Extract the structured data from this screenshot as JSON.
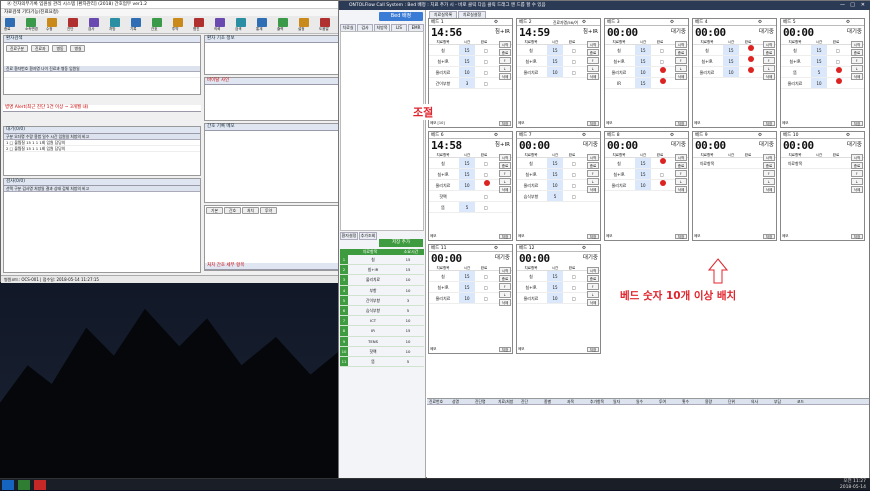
{
  "left_window": {
    "title": "Ⓐ 전자의무기록 입원실 관리 시스템 [환자관리] (2018) 간호업무 ver1.2",
    "menu": "자료검색   기타기능(진료요청)",
    "toolbar": [
      "종료",
      "소속변경",
      "수정",
      "진단",
      "검사",
      "처방",
      "기록",
      "간호",
      "투약",
      "협진",
      "의뢰",
      "검색",
      "통계",
      "출력",
      "설정",
      "도움말"
    ],
    "patient_panel_title": "환자검색",
    "patient_panel_fields": [
      "진료구분",
      "진료과",
      "병동",
      "병실"
    ],
    "patient_list_header": [
      "진료",
      "환자번호",
      "환자명",
      "나이",
      "진료과",
      "병동",
      "입원일"
    ],
    "alert_text": "병명 Alert(최근 진단 1건 이상 ~ 3개월 내)",
    "order_title": "대기(0/0)",
    "order_header": [
      "구분",
      "오더명",
      "수량",
      "용법",
      "일수",
      "시간",
      "입원일",
      "처방의",
      "비고"
    ],
    "order_rows": [
      [
        "1",
        "□",
        "물찜질",
        "15",
        "1",
        "1",
        "1회",
        "입원",
        "담당의"
      ],
      [
        "2",
        "□",
        "물찜질",
        "15",
        "1",
        "1",
        "1회",
        "입원",
        "담당의"
      ]
    ],
    "exam_title": "검사(0/0)",
    "exam_header": [
      "선택",
      "구분",
      "검사명",
      "처방일",
      "결과",
      "상태",
      "검체",
      "처방의",
      "비고"
    ],
    "status": "병원코드: OCS-001 | 접수일: 2018-05-14 11:27:15",
    "right_panel_title": "환자 기초 정보",
    "vitals_title": "바이탈 사인",
    "memo_title": "간호 기록 메모",
    "care_tabs": [
      "기본",
      "간호",
      "처치",
      "투약"
    ],
    "care_title": "처치 간호 세부 항목"
  },
  "annotation": {
    "label1": "조절",
    "label2": "베드 숫자 10개 이상 배치"
  },
  "right_window": {
    "title": "ONTOLFlow Call System : Bed 배정 : 치료 추가 시 - 바로 클릭 다음 클릭 드래그 앤 드롭 할 수 있음",
    "sidebar_tabs": [
      "치료실",
      "검사",
      "처방목록",
      "LIS",
      "EMR"
    ],
    "bed_button": "Bed 배정",
    "top_tabs": [
      "치료실목록",
      "치료실설정"
    ],
    "list_button": "저장 추가",
    "sidebar_header": [
      "치료항목",
      "소요시간"
    ],
    "sidebar_rows": [
      {
        "n": "1",
        "name": "침",
        "v": "15"
      },
      {
        "n": "2",
        "name": "침+IR",
        "v": "15"
      },
      {
        "n": "3",
        "name": "물리치료",
        "v": "10"
      },
      {
        "n": "4",
        "name": "부항",
        "v": "10"
      },
      {
        "n": "5",
        "name": "간이부항",
        "v": "3"
      },
      {
        "n": "6",
        "name": "습식부항",
        "v": "5"
      },
      {
        "n": "7",
        "name": "ICT",
        "v": "10"
      },
      {
        "n": "8",
        "name": "IR",
        "v": "15"
      },
      {
        "n": "9",
        "name": "TENS",
        "v": "10"
      },
      {
        "n": "10",
        "name": "핫팩",
        "v": "10"
      },
      {
        "n": "11",
        "name": "뜸",
        "v": "5"
      }
    ],
    "beds": [
      {
        "name": "베드 1",
        "time": "14:56",
        "status": "침+IR",
        "extra": "",
        "rows": [
          [
            "침",
            "15",
            "r"
          ],
          [
            "침+IR",
            "15",
            "r"
          ],
          [
            "물리치료",
            "10",
            "r"
          ],
          [
            "간이부항",
            "3",
            "r"
          ]
        ],
        "memo": "메모 [10]"
      },
      {
        "name": "베드 2",
        "time": "14:59",
        "status": "침+IR",
        "extra": "진료자명/56/여",
        "rows": [
          [
            "침",
            "15",
            "r"
          ],
          [
            "침+IR",
            "15",
            "r"
          ],
          [
            "물리치료",
            "10",
            "r"
          ]
        ],
        "memo": "메모"
      },
      {
        "name": "베드 3",
        "time": "00:00",
        "status": "대기중",
        "extra": "",
        "rows": [
          [
            "침",
            "15",
            "r"
          ],
          [
            "침+IR",
            "15",
            "r"
          ],
          [
            "물리치료",
            "10",
            "b"
          ],
          [
            "IR",
            "15",
            "b"
          ]
        ],
        "memo": "메모"
      },
      {
        "name": "베드 4",
        "time": "00:00",
        "status": "대기중",
        "extra": "",
        "rows": [
          [
            "침",
            "15",
            "b"
          ],
          [
            "침+IR",
            "15",
            "b"
          ],
          [
            "물리치료",
            "10",
            "b"
          ]
        ],
        "memo": "메모"
      },
      {
        "name": "베드 5",
        "time": "00:00",
        "status": "대기중",
        "extra": "",
        "rows": [
          [
            "침",
            "15",
            "r"
          ],
          [
            "침+IR",
            "15",
            "r"
          ],
          [
            "뜸",
            "5",
            "b"
          ],
          [
            "물리치료",
            "10",
            "b"
          ]
        ],
        "memo": "메모"
      },
      {
        "name": "베드 6",
        "time": "14:58",
        "status": "침+IR",
        "extra": "",
        "rows": [
          [
            "침",
            "15",
            "r"
          ],
          [
            "침+IR",
            "15",
            "r"
          ],
          [
            "물리치료",
            "10",
            "b"
          ],
          [
            "핫팩",
            "",
            "r"
          ],
          [
            "뜸",
            "5",
            "r"
          ]
        ],
        "memo": "메모"
      },
      {
        "name": "베드 7",
        "time": "00:00",
        "status": "대기중",
        "extra": "",
        "rows": [
          [
            "침",
            "15",
            "r"
          ],
          [
            "침+IR",
            "15",
            "r"
          ],
          [
            "물리치료",
            "10",
            "r"
          ],
          [
            "습식부항",
            "5",
            "r"
          ]
        ],
        "memo": "메모"
      },
      {
        "name": "베드 8",
        "time": "00:00",
        "status": "대기중",
        "extra": "",
        "rows": [
          [
            "침",
            "15",
            "b"
          ],
          [
            "침+IR",
            "15",
            "r"
          ],
          [
            "물리치료",
            "10",
            "b"
          ]
        ],
        "memo": "메모"
      },
      {
        "name": "베드 9",
        "time": "00:00",
        "status": "대기중",
        "extra": "",
        "rows": [
          [
            "치료항목",
            "",
            ""
          ]
        ],
        "memo": "메모"
      },
      {
        "name": "베드 10",
        "time": "00:00",
        "status": "대기중",
        "extra": "",
        "rows": [
          [
            "치료항목",
            "",
            ""
          ]
        ],
        "memo": "메모"
      },
      {
        "name": "베드 11",
        "time": "00:00",
        "status": "대기중",
        "extra": "",
        "rows": [
          [
            "침",
            "15",
            "r"
          ],
          [
            "침+IR",
            "15",
            "r"
          ],
          [
            "물리치료",
            "10",
            "r"
          ]
        ],
        "memo": "메모"
      },
      {
        "name": "베드 12",
        "time": "00:00",
        "status": "대기중",
        "extra": "",
        "rows": [
          [
            "침",
            "15",
            "r"
          ],
          [
            "침+IR",
            "15",
            "r"
          ],
          [
            "물리치료",
            "10",
            "r"
          ]
        ],
        "memo": "메모"
      }
    ],
    "card_header": [
      "치료항목",
      "시간",
      "완료"
    ],
    "bottom_header": [
      "진료번호",
      "성명",
      "진단명",
      "치료/처방",
      "진단",
      "종별",
      "과목",
      "추가항목",
      "일자",
      "일수",
      "투여",
      "횟수",
      "용량",
      "단위",
      "의사",
      "부담",
      "코드"
    ],
    "sidebar_bottom_tabs": [
      "환자설정",
      "추가조회"
    ]
  },
  "taskbar": {
    "time": "오전 11:27",
    "date": "2018-05-14"
  },
  "colors": {
    "accent": "#3a7bd5",
    "annotation_red": "#e0242d",
    "green": "#3f9b3f"
  }
}
